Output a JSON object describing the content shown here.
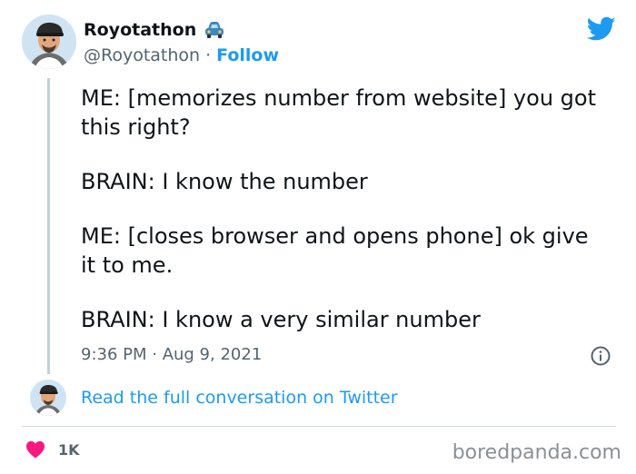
{
  "author": {
    "display_name": "Royotathon",
    "handle": "@Royotathon",
    "separator": "·",
    "follow_label": "Follow"
  },
  "tweet": {
    "paragraphs": [
      "ME: [memorizes number from website] you got this right?",
      "BRAIN: I know the number",
      "ME: [closes browser and opens phone] ok give it to me.",
      "BRAIN: I know a very similar number"
    ],
    "timestamp": "9:36 PM · Aug 9, 2021"
  },
  "conversation_link": "Read the full conversation on Twitter",
  "likes": {
    "count": "1K"
  },
  "watermark": "boredpanda.com",
  "colors": {
    "accent": "#1d9bf0",
    "heart": "#f91880",
    "text_primary": "#0f1419",
    "text_secondary": "#536471"
  },
  "icons": [
    "car-emoji-icon",
    "twitter-bird-icon",
    "info-icon",
    "heart-icon"
  ]
}
